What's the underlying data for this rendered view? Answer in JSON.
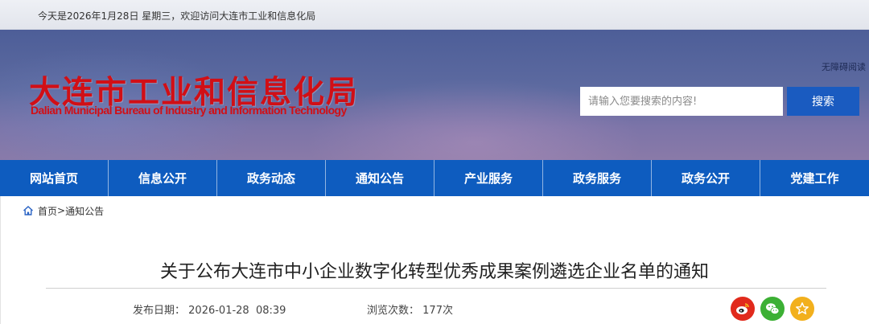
{
  "topbar": {
    "greeting": "今天是2026年1月28日 星期三，欢迎访问大连市工业和信息化局"
  },
  "header": {
    "logo_cn": "大连市工业和信息化局",
    "logo_en": "Dalian Municipal Bureau of Industry and Information Technology",
    "accessibility": "无障碍阅读",
    "search": {
      "placeholder": "请输入您要搜索的内容!",
      "button_label": "搜索"
    }
  },
  "nav": {
    "items": [
      {
        "label": "网站首页"
      },
      {
        "label": "信息公开"
      },
      {
        "label": "政务动态"
      },
      {
        "label": "通知公告"
      },
      {
        "label": "产业服务"
      },
      {
        "label": "政务服务"
      },
      {
        "label": "政务公开"
      },
      {
        "label": "党建工作"
      }
    ]
  },
  "breadcrumb": {
    "home": "首页",
    "separator": ">",
    "current": "通知公告"
  },
  "article": {
    "title": "关于公布大连市中小企业数字化转型优秀成果案例遴选企业名单的通知",
    "publish_label": "发布日期：",
    "publish_date": "2026-01-28  08:39",
    "views_label": "浏览次数：",
    "views_count": "177次"
  },
  "share": {
    "icons": [
      "weibo-icon",
      "wechat-icon",
      "favorite-star-icon"
    ]
  },
  "colors": {
    "nav_bg": "#0e5cbf",
    "search_button": "#1a5bc0",
    "logo_red": "#d10f16",
    "weibo": "#e12a1c",
    "wechat": "#3cb034",
    "favorite": "#f2b01d"
  }
}
